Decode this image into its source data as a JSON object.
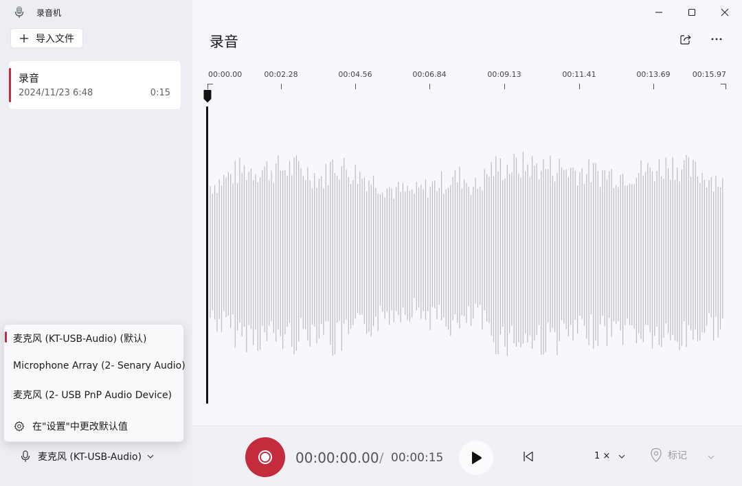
{
  "app": {
    "title": "录音机"
  },
  "sidebar": {
    "import_label": "导入文件",
    "recordings": [
      {
        "name": "录音",
        "date": "2024/11/23 6:48",
        "duration": "0:15"
      }
    ],
    "mic_menu": {
      "items": [
        {
          "label": "麦克风 (KT-USB-Audio) (默认)",
          "selected": true
        },
        {
          "label": "Microphone Array (2- Senary Audio)",
          "selected": false
        },
        {
          "label": "麦克风 (2- USB PnP Audio Device)",
          "selected": false
        }
      ],
      "settings_label": "在\"设置\"中更改默认值"
    },
    "current_mic": "麦克风 (KT-USB-Audio)"
  },
  "main": {
    "title": "录音",
    "timeline_labels": [
      "00:00.00",
      "00:02.28",
      "00:04.56",
      "00:06.84",
      "00:09.13",
      "00:11.41",
      "00:13.69",
      "00:15.97"
    ]
  },
  "player": {
    "current_time": "00:00:00.00",
    "separator": "/",
    "total_time": "00:00:15",
    "speed": "1 ×",
    "mark_label": "标记"
  },
  "colors": {
    "accent": "#c42b3c",
    "waveform": "#b9bbbf"
  }
}
